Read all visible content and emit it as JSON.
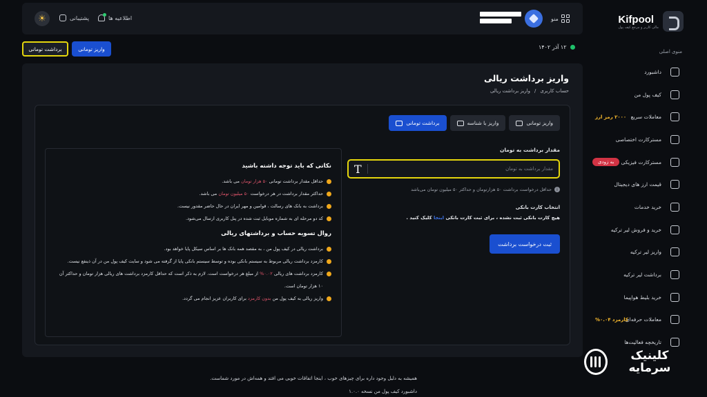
{
  "sidebar": {
    "logo_name": "Kifpool",
    "logo_tagline": "مالی کاربر و مرجع کیف پول",
    "menu_title": "منوی اصلی",
    "items": [
      {
        "label": "داشبورد",
        "icon": "dashboard-icon"
      },
      {
        "label": "کیف پول من",
        "icon": "wallet-icon"
      },
      {
        "label": "معاملات سریع",
        "icon": "swap-icon",
        "badge": "۲۰۰۰ رمز ارز"
      },
      {
        "label": "مسترکارت اختصاصی",
        "icon": "card-icon"
      },
      {
        "label": "مسترکارت فیزیکی",
        "icon": "card-icon",
        "badge": "به زودی"
      },
      {
        "label": "قیمت ارز های دیجیتال",
        "icon": "chart-icon"
      },
      {
        "label": "خرید خدمات",
        "icon": "services-icon"
      },
      {
        "label": "خرید و فروش لیر ترکیه",
        "icon": "exchange-icon"
      },
      {
        "label": "واریز لیر ترکیه",
        "icon": "deposit-icon"
      },
      {
        "label": "برداشت لیر ترکیه",
        "icon": "withdraw-icon"
      },
      {
        "label": "خرید بلیط هواپیما",
        "icon": "plane-icon"
      },
      {
        "label": "معاملات حرفه‌ای",
        "icon": "pro-trade-icon",
        "badge": "کارمزد ۰.۰۴%"
      },
      {
        "label": "تاریخچه فعالیت‌ها",
        "icon": "history-icon"
      }
    ],
    "watermark": "کلینیک سرمایه"
  },
  "topbar": {
    "menu_label": "منو",
    "notifications_label": "اطلاعیه ها",
    "support_label": "پشتیبانی",
    "theme_icon": "sun-icon"
  },
  "date": "۱۲ آذر ۱۴۰۲",
  "quick_buttons": {
    "deposit": "واریز تومانی",
    "withdraw": "برداشت تومانی"
  },
  "page": {
    "title": "واریز برداشت ریالی",
    "breadcrumb": [
      "حساب کاربری",
      "واریز برداشت ریالی"
    ]
  },
  "tabs": [
    {
      "label": "واریز تومانی",
      "active": false
    },
    {
      "label": "واریز با شناسه",
      "active": false
    },
    {
      "label": "برداشت تومانی",
      "active": true
    }
  ],
  "form": {
    "amount_label": "مقدار برداشت به تومان",
    "amount_placeholder": "مقدار برداشت به تومان",
    "hint": "حداقل درخواست برداشت ۵۰ هزارتومان و حداکثر ۵۰ میلیون تومان می‌باشد",
    "bank_label": "انتخاب کارت بانکی",
    "bank_text_before": "هیچ کارت بانکی ثبت نشده ، برای ثبت کارت بانکی",
    "bank_link": "اینجا",
    "bank_text_after": "کلیک کنید .",
    "submit": "ثبت درخواست برداشت"
  },
  "notes": {
    "title1": "نکاتی که باید توجه داشته باشید",
    "items1": [
      {
        "pre": "حداقل مقدار برداشت تومانی",
        "hl": "۵۰ هزار تومان",
        "post": "می باشد."
      },
      {
        "pre": "حداکثر مقدار برداشت در هر درخواست",
        "hl": "۵۰ میلیون تومان",
        "post": "می باشد."
      },
      {
        "pre": "برداشت به بانک های رسالت ، قوامین و مهر ایران در حال حاضر مقدور نیست.",
        "hl": "",
        "post": ""
      },
      {
        "pre": "کد دو مرحله ای به شماره موبایل ثبت شده در پنل کاربری ارسال می‌شود.",
        "hl": "",
        "post": ""
      }
    ],
    "title2": "روال تسویه حساب و برداشتهای ریالی",
    "items2": [
      {
        "pre": "برداشت ریالی در کیف پول من ، به مقصد همه بانک ها بر اساس سیکل پایا خواهد بود.",
        "hl": "",
        "post": ""
      },
      {
        "pre": "کارمزد برداشت ریالی مربوط به سیستم بانکی بوده و توسط سیستم بانکی پایا از گرفته می شود و سایت کیف پول من در آن ذینفع نیست.",
        "hl": "",
        "post": ""
      },
      {
        "pre": "کارمزد برداشت های ریالی",
        "hl": "۰.۰۲%",
        "post": "از مبلغ هر درخواست است. لازم به ذکر است که حداقل کارمزد برداشت های ریالی هزار تومان و حداکثر آن ۱۰ هزار تومان است."
      },
      {
        "pre": "واریز ریالی به کیف پول من",
        "hl": "بدون کارمزد",
        "post": "برای کاربران عزیز انجام می گردد."
      }
    ]
  },
  "footer": {
    "line1": "همیشه به دلیل وجود داره برای چیزهای خوب ، اینجا اتفاقات خوبی می افتد و همه‌اش در مورد شماست.",
    "line2": "داشبورد کیف پول من نسخه ۱.۰.۰"
  },
  "colors": {
    "accent": "#1a4fd0",
    "highlight_border": "#e6d70d",
    "badge_gold": "#f5b82e",
    "badge_red": "#d23344",
    "bullet": "#f0a81c",
    "note_highlight": "#e0556b",
    "online": "#1fc16b"
  }
}
